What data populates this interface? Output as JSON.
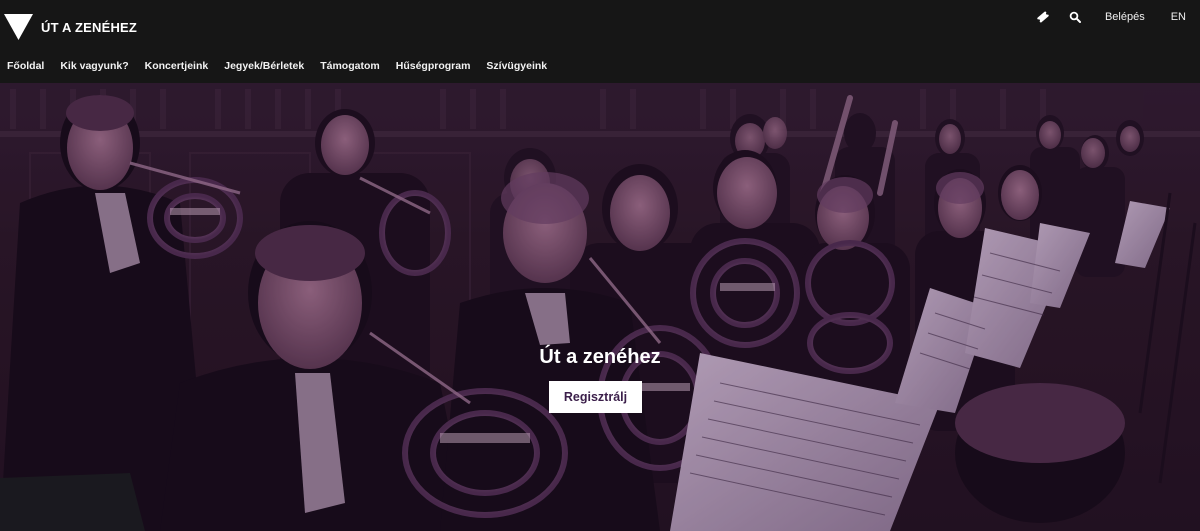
{
  "brand": {
    "name": "ÚT A ZENÉHEZ",
    "logo_icon": "triangle-logo-icon"
  },
  "utility": {
    "ticket_icon": "ticket-icon",
    "search_icon": "search-icon",
    "login_label": "Belépés",
    "language_label": "EN"
  },
  "nav": {
    "items": [
      {
        "label": "Főoldal"
      },
      {
        "label": "Kik vagyunk?"
      },
      {
        "label": "Koncertjeink"
      },
      {
        "label": "Jegyek/Bérletek"
      },
      {
        "label": "Támogatom"
      },
      {
        "label": "Hűségprogram"
      },
      {
        "label": "Szívügyeink"
      }
    ]
  },
  "hero": {
    "title": "Út a zenéhez",
    "cta_label": "Regisztrálj",
    "image_description_icon": "orchestra-horn-section-photo"
  },
  "colors": {
    "header_bg": "#161616",
    "hero_tint": "#3b1f4a",
    "button_bg": "#ffffff",
    "button_text": "#3b1f4a"
  }
}
